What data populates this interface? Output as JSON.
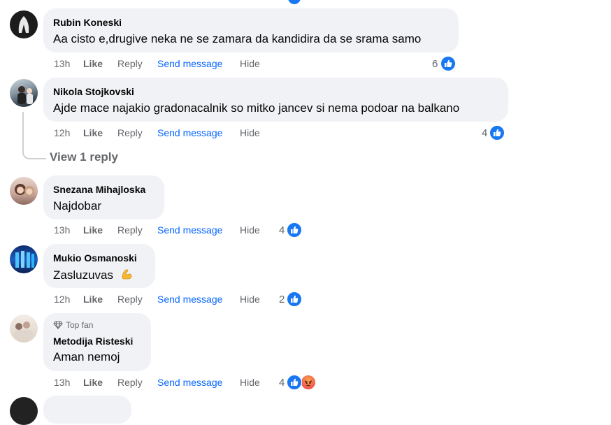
{
  "comments": [
    {
      "author": "Rubin Koneski",
      "text": "Aa cisto e,drugive neka ne se zamara da kandidira da se srama samo",
      "time": "13h",
      "like": "Like",
      "reply": "Reply",
      "send": "Send message",
      "hide": "Hide",
      "reaction_count": "6"
    },
    {
      "author": "Nikola Stojkovski",
      "text": "Ajde mace najakio gradonacalnik so mitko jancev si nema podoar na balkano",
      "time": "12h",
      "like": "Like",
      "reply": "Reply",
      "send": "Send message",
      "hide": "Hide",
      "reaction_count": "4",
      "view_replies": "View 1 reply"
    },
    {
      "author": "Snezana Mihajloska",
      "text": "Najdobar",
      "time": "13h",
      "like": "Like",
      "reply": "Reply",
      "send": "Send message",
      "hide": "Hide",
      "reaction_count": "4"
    },
    {
      "author": "Mukio Osmanoski",
      "text": "Zasluzuvas",
      "time": "12h",
      "like": "Like",
      "reply": "Reply",
      "send": "Send message",
      "hide": "Hide",
      "reaction_count": "2"
    },
    {
      "author": "Metodija Risteski",
      "badge": "Top fan",
      "text": "Aman nemoj",
      "time": "13h",
      "like": "Like",
      "reply": "Reply",
      "send": "Send message",
      "hide": "Hide",
      "reaction_count": "4"
    }
  ],
  "icons": {
    "like": "thumbs-up-icon",
    "angry": "angry-face-icon",
    "top_fan": "diamond-icon",
    "emoji": "flexed-biceps-icon"
  },
  "colors": {
    "link": "#0866ff",
    "like_blue": "#1877f2",
    "bubble": "#f0f2f5",
    "muted": "#65676b"
  }
}
